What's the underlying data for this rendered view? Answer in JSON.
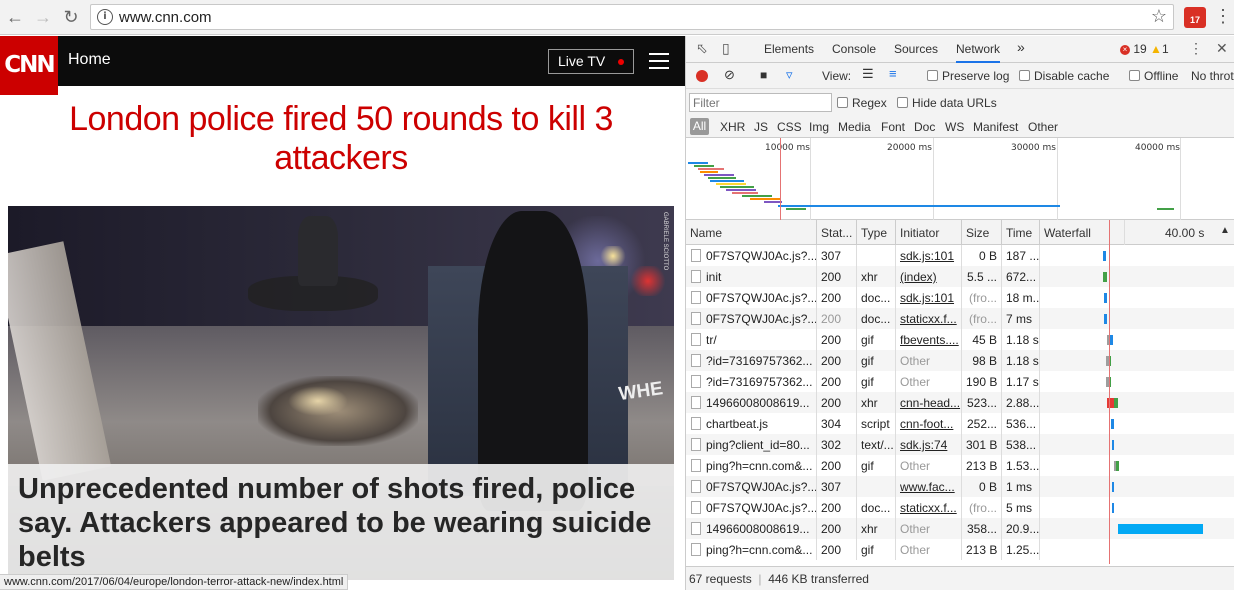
{
  "browser": {
    "url": "www.cnn.com",
    "ext_badge": "17",
    "status_url": "www.cnn.com/2017/06/04/europe/london-terror-attack-new/index.html"
  },
  "cnn": {
    "logo": "CNN",
    "nav_label": "Home",
    "live_tv": "Live TV",
    "headline": "London police fired 50 rounds to kill 3 attackers",
    "subhead": "Unprecedented number of shots fired, police say. Attackers appeared to be wearing suicide belts",
    "photo_credit": "GABRIELE SCIOTTO",
    "photo_sign": "WHE"
  },
  "devtools": {
    "tabs": [
      "Elements",
      "Console",
      "Sources",
      "Network"
    ],
    "more_tabs": "»",
    "errors": "19",
    "warnings": "1",
    "toolbar": {
      "view_label": "View:",
      "preserve_log": "Preserve log",
      "disable_cache": "Disable cache",
      "offline": "Offline",
      "throttle": "No thrott"
    },
    "filter": {
      "placeholder": "Filter",
      "regex": "Regex",
      "hide_data_urls": "Hide data URLs"
    },
    "type_filters": [
      "All",
      "XHR",
      "JS",
      "CSS",
      "Img",
      "Media",
      "Font",
      "Doc",
      "WS",
      "Manifest",
      "Other"
    ],
    "overview_ticks": [
      "10000 ms",
      "20000 ms",
      "30000 ms",
      "40000 ms"
    ],
    "columns": {
      "name": "Name",
      "status": "Stat...",
      "type": "Type",
      "initiator": "Initiator",
      "size": "Size",
      "time": "Time",
      "waterfall": "Waterfall",
      "waterfall_time": "40.00 s"
    },
    "requests": [
      {
        "name": "0F7S7QWJ0Ac.js?...",
        "status": "307",
        "type": "",
        "initiator": "sdk.js:101",
        "init_link": true,
        "size": "0 B",
        "time": "187 ..."
      },
      {
        "name": "init",
        "status": "200",
        "type": "xhr",
        "initiator": "(index)",
        "init_link": true,
        "size": "5.5 ...",
        "time": "672..."
      },
      {
        "name": "0F7S7QWJ0Ac.js?...",
        "status": "200",
        "type": "doc...",
        "initiator": "sdk.js:101",
        "init_link": true,
        "size": "(fro...",
        "time": "18 m..."
      },
      {
        "name": "0F7S7QWJ0Ac.js?...",
        "status": "200",
        "type": "doc...",
        "initiator": "staticxx.f...",
        "init_link": true,
        "size": "(fro...",
        "time": "7 ms"
      },
      {
        "name": "tr/",
        "status": "200",
        "type": "gif",
        "initiator": "fbevents....",
        "init_link": true,
        "size": "45 B",
        "time": "1.18 s"
      },
      {
        "name": "?id=73169757362...",
        "status": "200",
        "type": "gif",
        "initiator": "Other",
        "init_link": false,
        "size": "98 B",
        "time": "1.18 s"
      },
      {
        "name": "?id=73169757362...",
        "status": "200",
        "type": "gif",
        "initiator": "Other",
        "init_link": false,
        "size": "190 B",
        "time": "1.17 s"
      },
      {
        "name": "14966008008619...",
        "status": "200",
        "type": "xhr",
        "initiator": "cnn-head...",
        "init_link": true,
        "size": "523...",
        "time": "2.88..."
      },
      {
        "name": "chartbeat.js",
        "status": "304",
        "type": "script",
        "initiator": "cnn-foot...",
        "init_link": true,
        "size": "252...",
        "time": "536..."
      },
      {
        "name": "ping?client_id=80...",
        "status": "302",
        "type": "text/...",
        "initiator": "sdk.js:74",
        "init_link": true,
        "size": "301 B",
        "time": "538..."
      },
      {
        "name": "ping?h=cnn.com&...",
        "status": "200",
        "type": "gif",
        "initiator": "Other",
        "init_link": false,
        "size": "213 B",
        "time": "1.53..."
      },
      {
        "name": "0F7S7QWJ0Ac.js?...",
        "status": "307",
        "type": "",
        "initiator": "www.fac...",
        "init_link": true,
        "size": "0 B",
        "time": "1 ms"
      },
      {
        "name": "0F7S7QWJ0Ac.js?...",
        "status": "200",
        "type": "doc...",
        "initiator": "staticxx.f...",
        "init_link": true,
        "size": "(fro...",
        "time": "5 ms"
      },
      {
        "name": "14966008008619...",
        "status": "200",
        "type": "xhr",
        "initiator": "Other",
        "init_link": false,
        "size": "358...",
        "time": "20.9..."
      },
      {
        "name": "ping?h=cnn.com&...",
        "status": "200",
        "type": "gif",
        "initiator": "Other",
        "init_link": false,
        "size": "213 B",
        "time": "1.25..."
      }
    ],
    "summary_requests": "67 requests",
    "summary_sep": "|",
    "summary_transferred": "446 KB transferred"
  }
}
